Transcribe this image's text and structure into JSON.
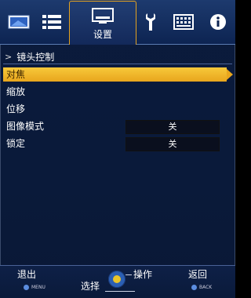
{
  "top_tabs": [
    {
      "name": "picture",
      "icon": "picture-icon"
    },
    {
      "name": "list",
      "icon": "list-icon"
    },
    {
      "name": "setup",
      "icon": "setup-icon",
      "label": "设置",
      "active": true
    },
    {
      "name": "wrench",
      "icon": "wrench-icon"
    },
    {
      "name": "grid",
      "icon": "grid-icon"
    },
    {
      "name": "info",
      "icon": "info-icon"
    }
  ],
  "breadcrumb": {
    "chevron": ">",
    "title": "镜头控制"
  },
  "menu": [
    {
      "label": "对焦",
      "selected": true,
      "value": ""
    },
    {
      "label": "缩放",
      "value": ""
    },
    {
      "label": "位移",
      "value": ""
    },
    {
      "label": "图像模式",
      "value": "关"
    },
    {
      "label": "锁定",
      "value": "关"
    }
  ],
  "bottom": {
    "exit": "退出",
    "exit_key": "MENU",
    "select": "选择",
    "operate": "操作",
    "back": "返回",
    "back_key": "BACK"
  },
  "colors": {
    "accent": "#E8A61D",
    "background": "#0B1B3C",
    "topbar": "#1D3A6E"
  }
}
